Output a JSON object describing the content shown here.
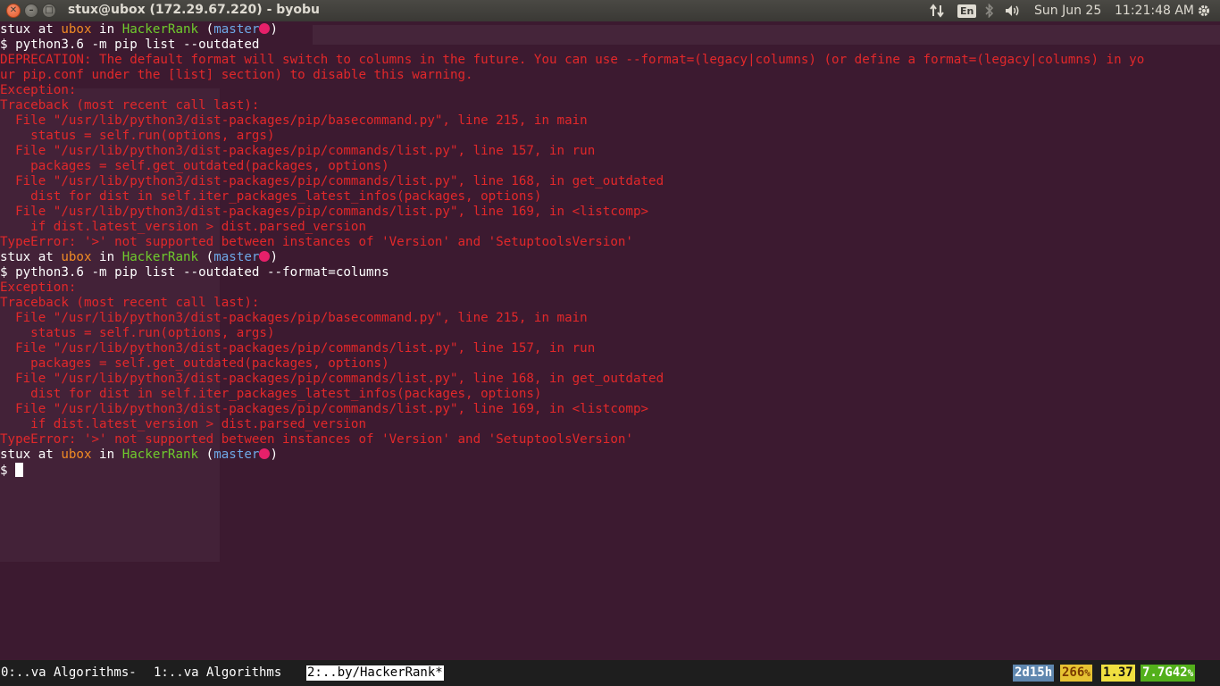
{
  "topbar": {
    "title": "stux@ubox (172.29.67.220) - byobu",
    "keyboard_layout": "En",
    "date": "Sun Jun 25",
    "time": "11:21:48 AM"
  },
  "icons": {
    "close": "close-icon",
    "minimize": "minimize-icon",
    "maximize": "maximize-icon",
    "network": "network-arrows-icon",
    "bluetooth": "bluetooth-icon",
    "volume": "volume-icon",
    "settings": "gear-icon"
  },
  "terminal": {
    "prompt": {
      "user": "stux",
      "at": " at ",
      "host": "ubox",
      "in": " in ",
      "dir": "HackerRank",
      "branch_open": " (",
      "branch": "master",
      "branch_close": ")"
    },
    "lines": [
      {
        "kind": "prompt"
      },
      {
        "kind": "cmd",
        "text": "$ python3.6 -m pip list --outdated"
      },
      {
        "kind": "err",
        "text": "DEPRECATION: The default format will switch to columns in the future. You can use --format=(legacy|columns) (or define a format=(legacy|columns) in yo"
      },
      {
        "kind": "err",
        "text": "ur pip.conf under the [list] section) to disable this warning."
      },
      {
        "kind": "err",
        "text": "Exception:"
      },
      {
        "kind": "err",
        "text": "Traceback (most recent call last):"
      },
      {
        "kind": "err",
        "text": "  File \"/usr/lib/python3/dist-packages/pip/basecommand.py\", line 215, in main"
      },
      {
        "kind": "err",
        "text": "    status = self.run(options, args)"
      },
      {
        "kind": "err",
        "text": "  File \"/usr/lib/python3/dist-packages/pip/commands/list.py\", line 157, in run"
      },
      {
        "kind": "err",
        "text": "    packages = self.get_outdated(packages, options)"
      },
      {
        "kind": "err",
        "text": "  File \"/usr/lib/python3/dist-packages/pip/commands/list.py\", line 168, in get_outdated"
      },
      {
        "kind": "err",
        "text": "    dist for dist in self.iter_packages_latest_infos(packages, options)"
      },
      {
        "kind": "err",
        "text": "  File \"/usr/lib/python3/dist-packages/pip/commands/list.py\", line 169, in <listcomp>"
      },
      {
        "kind": "err",
        "text": "    if dist.latest_version > dist.parsed_version"
      },
      {
        "kind": "err",
        "text": "TypeError: '>' not supported between instances of 'Version' and 'SetuptoolsVersion'"
      },
      {
        "kind": "prompt"
      },
      {
        "kind": "cmd",
        "text": "$ python3.6 -m pip list --outdated --format=columns"
      },
      {
        "kind": "err",
        "text": "Exception:"
      },
      {
        "kind": "err",
        "text": "Traceback (most recent call last):"
      },
      {
        "kind": "err",
        "text": "  File \"/usr/lib/python3/dist-packages/pip/basecommand.py\", line 215, in main"
      },
      {
        "kind": "err",
        "text": "    status = self.run(options, args)"
      },
      {
        "kind": "err",
        "text": "  File \"/usr/lib/python3/dist-packages/pip/commands/list.py\", line 157, in run"
      },
      {
        "kind": "err",
        "text": "    packages = self.get_outdated(packages, options)"
      },
      {
        "kind": "err",
        "text": "  File \"/usr/lib/python3/dist-packages/pip/commands/list.py\", line 168, in get_outdated"
      },
      {
        "kind": "err",
        "text": "    dist for dist in self.iter_packages_latest_infos(packages, options)"
      },
      {
        "kind": "err",
        "text": "  File \"/usr/lib/python3/dist-packages/pip/commands/list.py\", line 169, in <listcomp>"
      },
      {
        "kind": "err",
        "text": "    if dist.latest_version > dist.parsed_version"
      },
      {
        "kind": "err",
        "text": "TypeError: '>' not supported between instances of 'Version' and 'SetuptoolsVersion'"
      },
      {
        "kind": "prompt"
      },
      {
        "kind": "input",
        "text": "$ "
      }
    ]
  },
  "statusbar": {
    "windows": [
      {
        "label": "0:..va Algorithms-",
        "active": false
      },
      {
        "label": "1:..va Algorithms",
        "active": false
      },
      {
        "label": "2:..by/HackerRank*",
        "active": true
      }
    ],
    "uptime": "2d15h",
    "processes": "266",
    "processes_suffix": "%",
    "load": "1.37",
    "memory": "7.7G42",
    "memory_suffix": "%"
  },
  "colors": {
    "terminal_bg": "#3c1a30",
    "error_text": "#e2282a",
    "host_orange": "#f08a24",
    "dir_green": "#6fcb2d",
    "branch_blue": "#6ea8e6",
    "dirty_dot": "#e6206a"
  }
}
